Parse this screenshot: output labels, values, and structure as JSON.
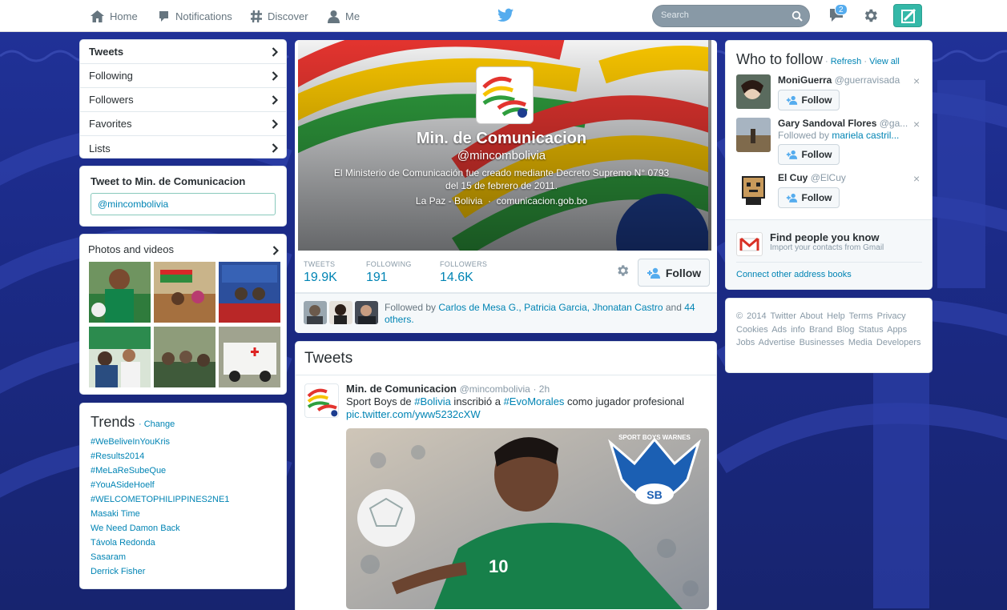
{
  "nav": {
    "home": "Home",
    "notifications": "Notifications",
    "discover": "Discover",
    "me": "Me",
    "search_placeholder": "Search",
    "notification_count": "2"
  },
  "sidebar": {
    "items": [
      {
        "label": "Tweets"
      },
      {
        "label": "Following"
      },
      {
        "label": "Followers"
      },
      {
        "label": "Favorites"
      },
      {
        "label": "Lists"
      }
    ],
    "tweet_to": "Tweet to Min. de Comunicacion",
    "tweet_to_value": "@mincombolivia",
    "photos_label": "Photos and videos"
  },
  "trends": {
    "title": "Trends",
    "change": "· Change",
    "items": [
      "#WeBeliveInYouKris",
      "#Results2014",
      "#MeLaReSubeQue",
      "#YouASideHoelf",
      "#WELCOMETOPHILIPPINES2NE1",
      "Masaki Time",
      "We Need Damon Back",
      "Távola Redonda",
      "Sasaram",
      "Derrick Fisher"
    ]
  },
  "profile": {
    "name": "Min. de Comunicacion",
    "handle": "@mincombolivia",
    "bio": "El Ministerio de Comunicación fue creado mediante Decreto Supremo N° 0793 del 15 de febrero de 2011.",
    "location": "La Paz - Bolivia",
    "separator": "·",
    "website": "comunicacion.gob.bo",
    "stats": [
      {
        "label": "TWEETS",
        "value": "19.9K"
      },
      {
        "label": "FOLLOWING",
        "value": "191"
      },
      {
        "label": "FOLLOWERS",
        "value": "14.6K"
      }
    ],
    "follow_label": "Follow",
    "followed_by_prefix": "Followed by",
    "followed_by_names": "Carlos de Mesa G., Patricia Garcia, Jhonatan Castro",
    "followed_by_and": "and",
    "followed_by_others": "44 others."
  },
  "tweets": {
    "title": "Tweets",
    "items": [
      {
        "name": "Min. de Comunicacion",
        "handle": "@mincombolivia",
        "time": "· 2h",
        "text_1": "Sport Boys de ",
        "tag_1": "#Bolivia",
        "text_2": " inscribió a ",
        "tag_2": "#EvoMorales",
        "text_3": " como jugador profesional",
        "link": "pic.twitter.com/yww5232cXW",
        "media_badge": "SPORT BOYS WARNES",
        "media_logo": "SB",
        "jersey_number": "10"
      }
    ]
  },
  "who_to_follow": {
    "title": "Who to follow",
    "refresh": "Refresh",
    "view_all": "View all",
    "dot": "·",
    "suggestions": [
      {
        "name": "MoniGuerra",
        "handle": "@guerravisada",
        "sub": ""
      },
      {
        "name": "Gary Sandoval Flores",
        "handle": "@ga...",
        "sub_prefix": "Followed by",
        "sub": "mariela castril..."
      },
      {
        "name": "El Cuy",
        "handle": "@ElCuy",
        "sub": ""
      }
    ],
    "follow_label": "Follow",
    "dismiss": "×",
    "find_title": "Find people you know",
    "find_sub": "Import your contacts from Gmail",
    "connect": "Connect other address books"
  },
  "footer": {
    "text": "© 2014 Twitter About Help Terms Privacy Cookies Ads info Brand Blog Status Apps Jobs Advertise Businesses Media Developers"
  },
  "colors": {
    "accent": "#0084b4",
    "teal_compose": "#34b8a8",
    "background": "#1c2a7a"
  }
}
